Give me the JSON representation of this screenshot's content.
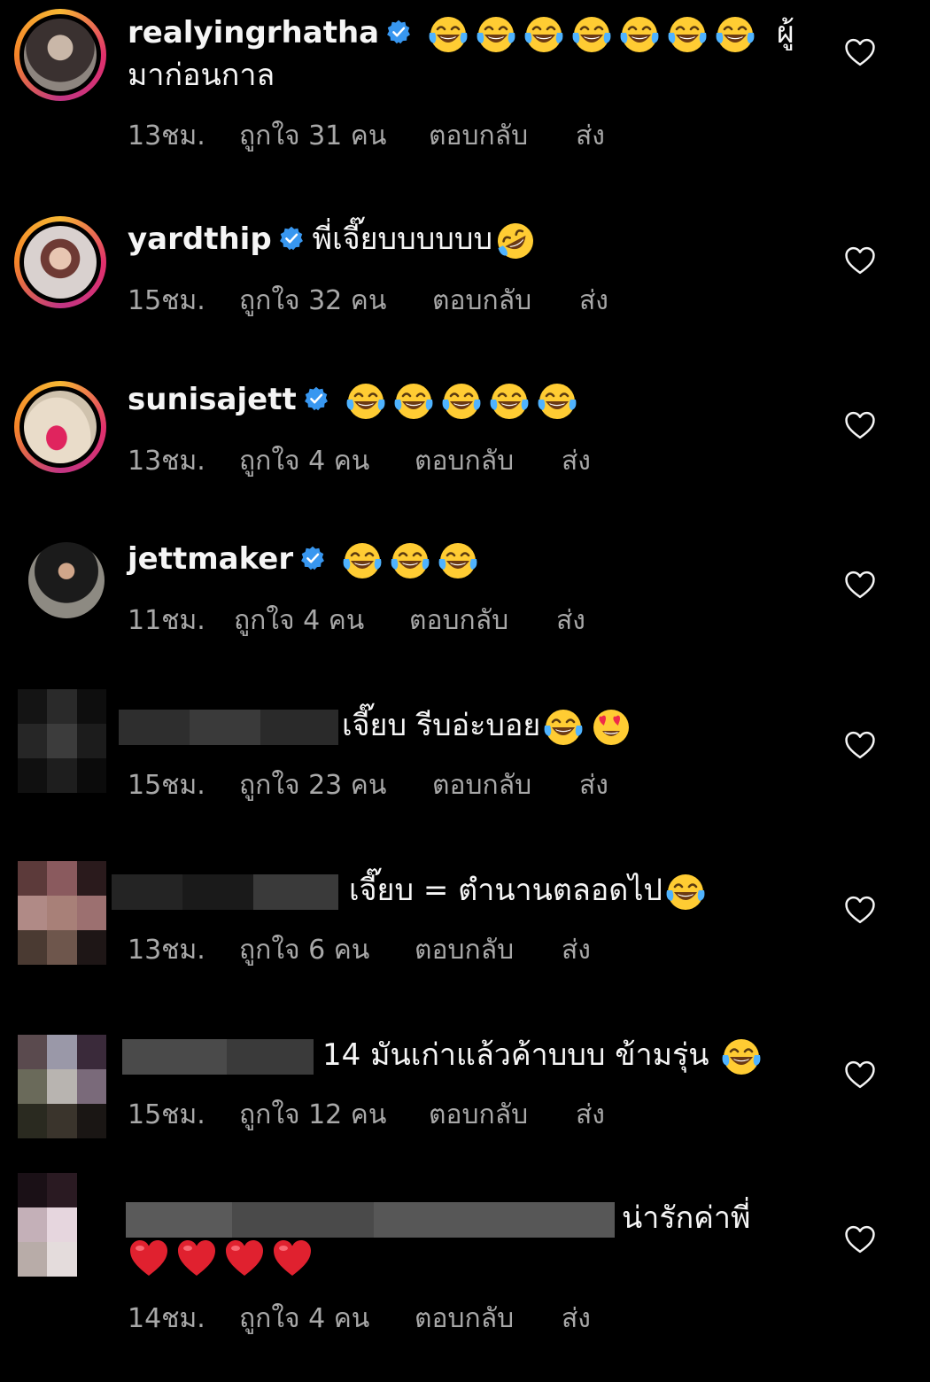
{
  "comments": [
    {
      "username": "realyingrhatha",
      "text": "ผู้",
      "text_line2": "มาก่อนกาล",
      "time": "13ชม.",
      "likes": "ถูกใจ 31 คน",
      "reply": "ตอบกลับ",
      "send": "ส่ง",
      "emoji": [
        "laughing-tears",
        "laughing-tears",
        "laughing-tears",
        "laughing-tears",
        "laughing-tears",
        "laughing-tears",
        "laughing-tears"
      ]
    },
    {
      "username": "yardthip",
      "text": "พี่เจี๊ยบบบบบบ",
      "time": "15ชม.",
      "likes": "ถูกใจ 32 คน",
      "reply": "ตอบกลับ",
      "send": "ส่ง",
      "emoji": [
        "rolling-laughing"
      ]
    },
    {
      "username": "sunisajett",
      "time": "13ชม.",
      "likes": "ถูกใจ 4 คน",
      "reply": "ตอบกลับ",
      "send": "ส่ง",
      "emoji": [
        "laughing-tears",
        "laughing-tears",
        "laughing-tears",
        "laughing-tears",
        "laughing-tears"
      ]
    },
    {
      "username": "jettmaker",
      "time": "11ชม.",
      "likes": "ถูกใจ 4 คน",
      "reply": "ตอบกลับ",
      "send": "ส่ง",
      "emoji": [
        "laughing-tears",
        "laughing-tears",
        "laughing-tears"
      ]
    },
    {
      "text": "เจี๊ยบ รีบอ่ะบอย",
      "time": "15ชม.",
      "likes": "ถูกใจ 23 คน",
      "reply": "ตอบกลับ",
      "send": "ส่ง",
      "emoji": [
        "laughing-tears",
        "heart-eyes"
      ]
    },
    {
      "text": "เจี๊ยบ = ตำนานตลอดไป",
      "time": "13ชม.",
      "likes": "ถูกใจ 6 คน",
      "reply": "ตอบกลับ",
      "send": "ส่ง",
      "emoji": [
        "laughing-tears"
      ]
    },
    {
      "text": "14 มันเก่าแล้วค้าบบบ ข้ามรุ่น",
      "time": "15ชม.",
      "likes": "ถูกใจ 12 คน",
      "reply": "ตอบกลับ",
      "send": "ส่ง",
      "emoji": [
        "laughing-tears"
      ]
    },
    {
      "text": "น่ารักค่าพี่",
      "time": "14ชม.",
      "likes": "ถูกใจ 4 คน",
      "reply": "ตอบกลับ",
      "send": "ส่ง",
      "emoji": [
        "red-heart",
        "red-heart",
        "red-heart",
        "red-heart"
      ]
    }
  ],
  "icons": {
    "verified": "verified-badge-icon",
    "like": "heart-outline-icon"
  },
  "colors": {
    "background": "#000000",
    "text": "#f5f5f5",
    "meta": "#a8a8a8",
    "verified": "#3897f0"
  }
}
